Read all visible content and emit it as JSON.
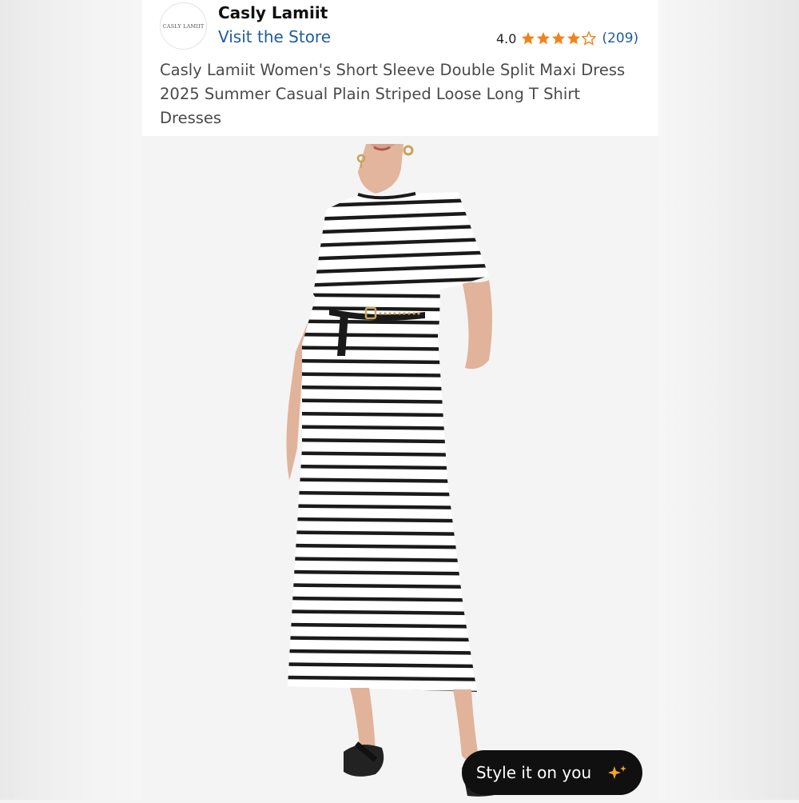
{
  "header": {
    "logo_text": "CASLY LAMIIT",
    "brand": "Casly Lamiit",
    "visit_store": "Visit the Store",
    "rating_value": "4.0",
    "rating_stars": 4,
    "rating_max": 5,
    "review_count": "(209)",
    "title": "Casly Lamiit Women's Short Sleeve Double Split Maxi Dress 2025 Summer Casual Plain Striped Loose Long T Shirt Dresses"
  },
  "colors": {
    "star": "#f0841c",
    "link": "#1f5d9c",
    "stripe": "#1a1a1a",
    "sparkle": "#f6a623"
  },
  "icons": {
    "stars": "star-icon",
    "sparkle": "sparkle-icon"
  },
  "style_button": {
    "label": "Style it on you"
  }
}
